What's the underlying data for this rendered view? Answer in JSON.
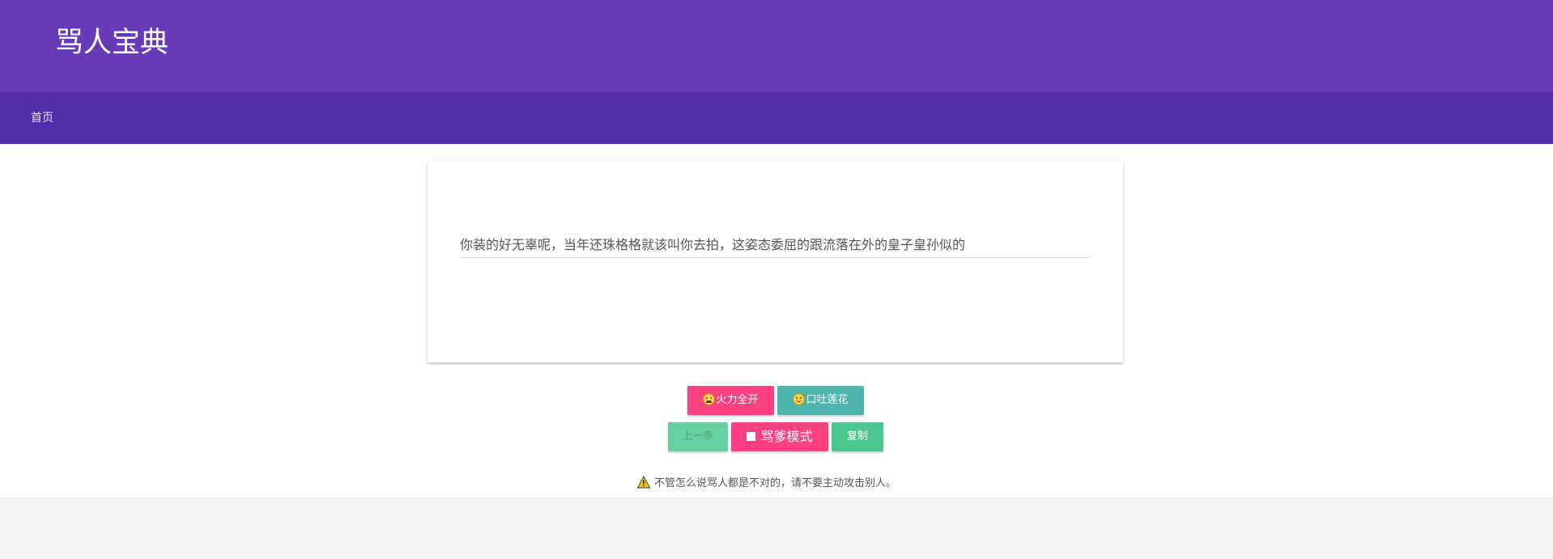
{
  "header": {
    "title": "骂人宝典"
  },
  "nav": {
    "items": [
      {
        "label": "首页"
      }
    ]
  },
  "card": {
    "text": "你装的好无辜呢，当年还珠格格就该叫你去拍，这姿态委屈的跟流落在外的皇子皇孙似的"
  },
  "controls": {
    "fire_full": {
      "label": "火力全开",
      "icon": "angry-face-emoji-icon"
    },
    "lotus": {
      "label": "口吐莲花",
      "icon": "smiling-face-emoji-icon"
    },
    "prev": {
      "label": "上一条"
    },
    "mode": {
      "label": "骂爹模式",
      "checked": false
    },
    "copy": {
      "label": "复制"
    }
  },
  "notice": {
    "text": "不管怎么说骂人都是不对的，请不要主动攻击别人。",
    "icon": "warning-icon"
  },
  "colors": {
    "header": "#673ab7",
    "navbar": "#512da8",
    "pink": "#ff4081",
    "teal": "#4db6ac",
    "green": "#4cc790"
  }
}
